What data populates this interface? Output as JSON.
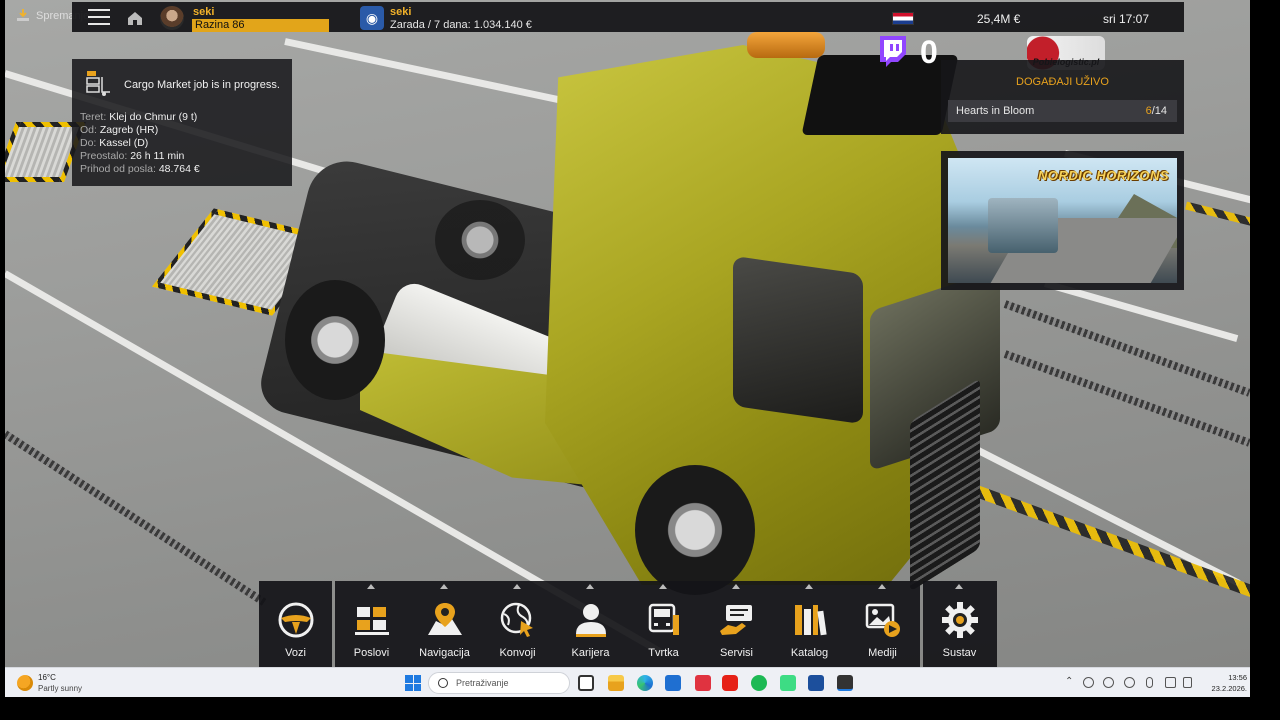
{
  "topbar": {
    "save_label": "Spremanje",
    "player_name": "seki",
    "level_label": "Razina 86",
    "level_progress_percent": 100,
    "company_name": "seki",
    "company_profit": "Zarada / 7 dana: 1.034.140 €",
    "money": "25,4M €",
    "clock": "sri 17:07"
  },
  "job": {
    "title": "Cargo Market job is in progress.",
    "rows": [
      {
        "label": "Teret:",
        "value": "Klej do Chmur (9 t)"
      },
      {
        "label": "Od:",
        "value": "Zagreb (HR)"
      },
      {
        "label": "Do:",
        "value": "Kassel (D)"
      },
      {
        "label": "Preostalo:",
        "value": "26 h 11 min"
      },
      {
        "label": "Prihod od posla:",
        "value": "48.764 €"
      }
    ]
  },
  "stream": {
    "twitch_count": "0",
    "sponsor": "Pobielogistic.pl"
  },
  "events": {
    "title": "DOGAĐAJI UŽIVO",
    "name": "Hearts in Bloom",
    "progress_current": "6",
    "progress_total": "/14"
  },
  "promo": {
    "title": "NORDIC HORIZONS"
  },
  "menu": {
    "items": [
      {
        "label": "Vozi",
        "icon": "steering-wheel-icon"
      },
      {
        "label": "Poslovi",
        "icon": "cargo-boxes-icon"
      },
      {
        "label": "Navigacija",
        "icon": "map-pin-icon"
      },
      {
        "label": "Konvoji",
        "icon": "globe-cursor-icon"
      },
      {
        "label": "Karijera",
        "icon": "person-icon"
      },
      {
        "label": "Tvrtka",
        "icon": "truck-front-icon"
      },
      {
        "label": "Servisi",
        "icon": "service-icon"
      },
      {
        "label": "Katalog",
        "icon": "catalog-icon"
      },
      {
        "label": "Mediji",
        "icon": "media-icon"
      },
      {
        "label": "Sustav",
        "icon": "gear-icon"
      }
    ]
  },
  "taskbar": {
    "weather_temp": "16°C",
    "weather_desc": "Partly sunny",
    "search_placeholder": "Pretraživanje",
    "time": "13:56",
    "date": "23.2.2026."
  },
  "colors": {
    "accent": "#e8a21d",
    "panel": "#18181c",
    "twitch": "#9146ff"
  }
}
